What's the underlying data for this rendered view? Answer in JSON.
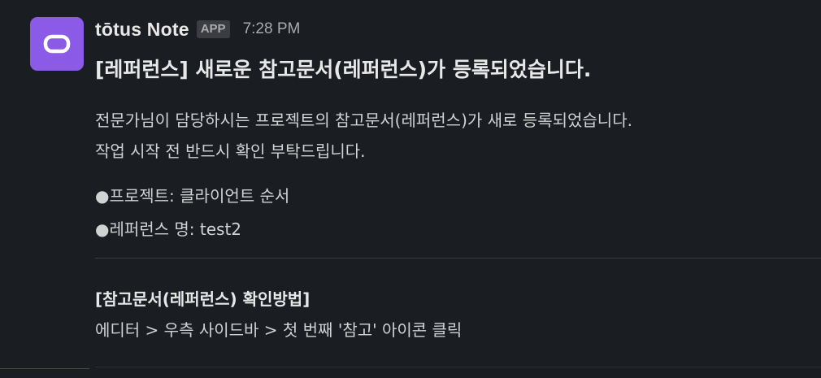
{
  "message": {
    "sender": "tōtus Note",
    "badge": "APP",
    "time": "7:28 PM",
    "title": "[레퍼런스] 새로운 참고문서(레퍼런스)가 등록되었습니다.",
    "body_line_1": "전문가님이 담당하시는 프로젝트의 참고문서(레퍼런스)가 새로 등록되었습니다.",
    "body_line_2": "작업 시작 전 반드시 확인 부탁드립니다.",
    "project_line": "●프로젝트: 클라이언트 순서",
    "reference_line": "●레퍼런스 명: test2",
    "howto_title": "[참고문서(레퍼런스) 확인방법]",
    "howto_body": "에디터 > 우측 사이드바 > 첫 번째 '참고' 아이콘 클릭"
  },
  "avatar": {
    "background": "#8b5be8",
    "icon": "rounded-rectangle-logo-icon"
  }
}
